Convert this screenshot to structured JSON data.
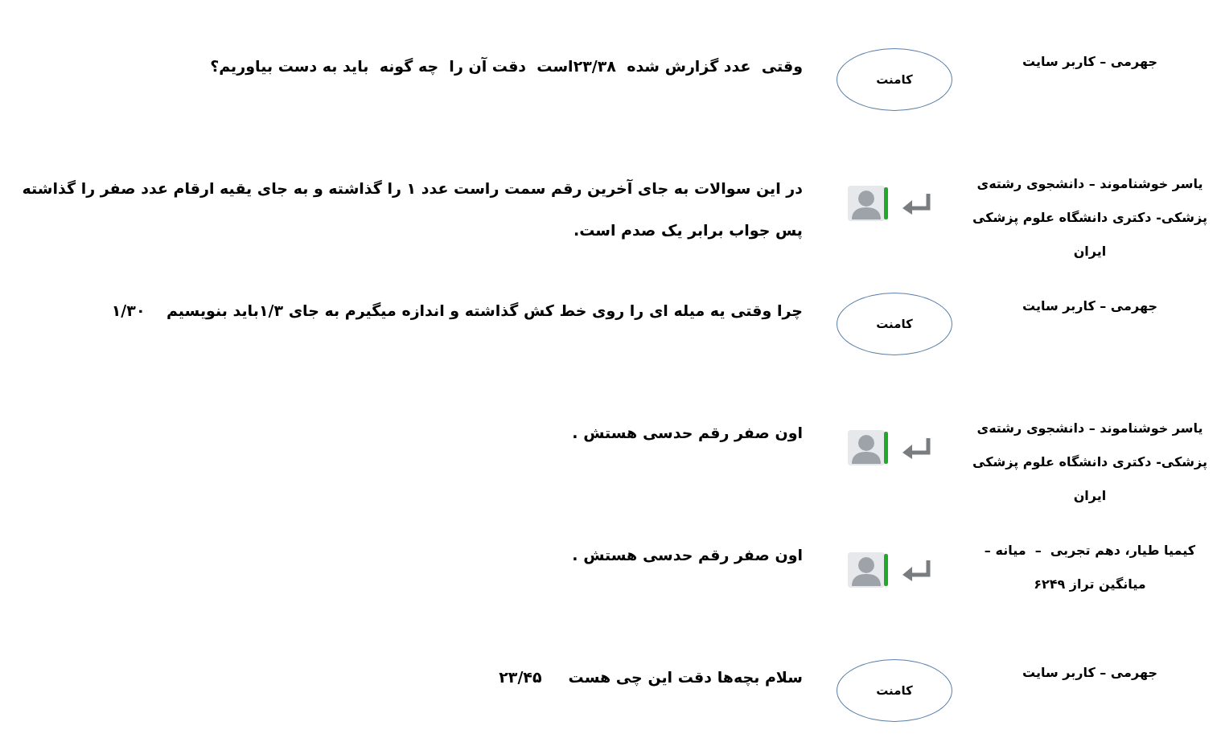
{
  "comments": [
    {
      "author": "جهرمی – کاربر سایت",
      "kind": "comment",
      "badge": "کامنت",
      "text": "وقتی  عدد گزارش شده  ۲۳/۳۸است  دقت آن را  چه گونه  باید به دست بیاوریم؟"
    },
    {
      "author": "یاسر خوشناموند – دانشجوی رشته‌ی پزشکی- دکتری دانشگاه علوم پزشکی ایران",
      "kind": "reply",
      "text": "در این سوالات به جای آخرین رقم سمت راست عدد ۱ را گذاشته و به جای یقیه ارقام عدد صفر را گذاشته پس جواب برابر یک صدم است."
    },
    {
      "author": "جهرمی – کاربر سایت",
      "kind": "comment",
      "badge": "کامنت",
      "text": "چرا وقتی یه میله ای را روی خط کش گذاشته و اندازه میگیرم به جای ۱/۳باید بنویسیم    ۱/۳۰"
    },
    {
      "author": "یاسر خوشناموند – دانشجوی رشته‌ی پزشکی- دکتری دانشگاه علوم پزشکی ایران",
      "kind": "reply",
      "text": "اون صفر رقم حدسی هستش ."
    },
    {
      "author": "کیمیا طیار، دهم تجربی  –  میانه – میانگین تراز ۶۲۴۹",
      "kind": "reply",
      "text": "اون صفر رقم حدسی هستش ."
    },
    {
      "author": "جهرمی – کاربر سایت",
      "kind": "comment",
      "badge": "کامنت",
      "text": "سلام بچه‌ها دقت این چی هست     ۲۳/۴۵"
    }
  ]
}
